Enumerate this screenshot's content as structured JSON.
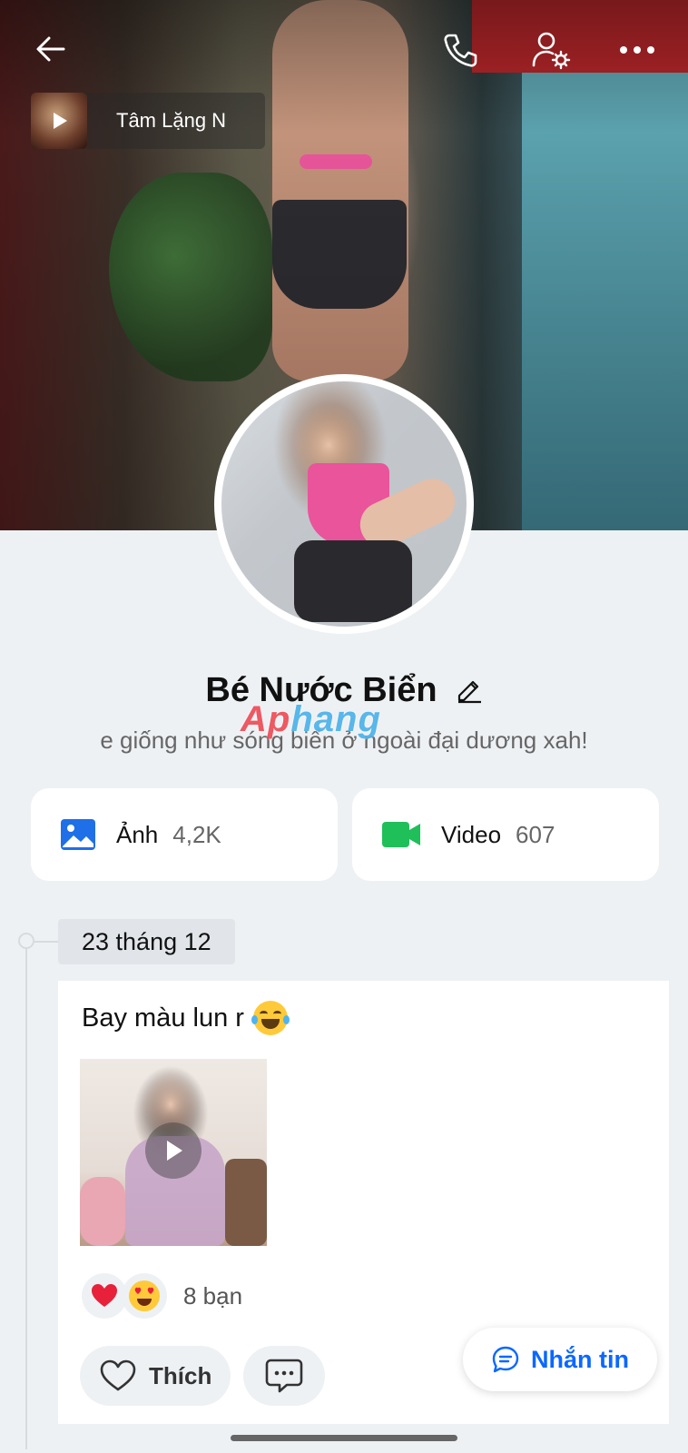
{
  "header": {
    "back_icon": "arrow-left-icon",
    "call_icon": "phone-icon",
    "settings_icon": "user-gear-icon",
    "more_icon": "more-horizontal-icon"
  },
  "music": {
    "title": "Tâm Lặng N"
  },
  "profile": {
    "name": "Bé Nước Biển",
    "bio": "e giống như sóng biển ở ngoài đại dương xah!"
  },
  "watermark": {
    "part1": "Ap",
    "part2": "hang"
  },
  "media": {
    "photos": {
      "label": "Ảnh",
      "count": "4,2K"
    },
    "videos": {
      "label": "Video",
      "count": "607"
    }
  },
  "timeline": {
    "date": "23 tháng 12"
  },
  "post": {
    "text": "Bay màu lun r",
    "reaction_count": "8 bạn",
    "like_label": "Thích"
  },
  "message_button": {
    "label": "Nhắn tin"
  },
  "colors": {
    "accent": "#0a68ff",
    "photo_icon": "#1e6fe8",
    "video_icon": "#1fbf5a"
  }
}
